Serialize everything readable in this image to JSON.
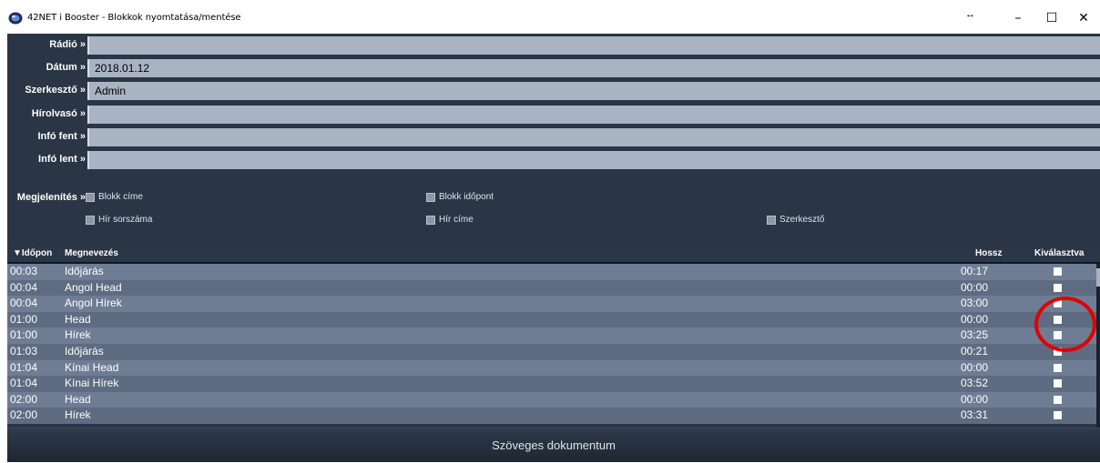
{
  "window": {
    "title": "42NET i Booster - Blokkok nyomtatása/mentése",
    "resize_glyph": "↔",
    "minimize_glyph": "–",
    "maximize_glyph": "☐",
    "close_glyph": "✕"
  },
  "form": {
    "fields": [
      {
        "label": "Rádió »",
        "value": ""
      },
      {
        "label": "Dátum »",
        "value": "2018.01.12"
      },
      {
        "label": "Szerkesztő »",
        "value": "Admin"
      },
      {
        "label": "Hírolvasó »",
        "value": ""
      },
      {
        "label": "Infó fent »",
        "value": ""
      },
      {
        "label": "Infó lent »",
        "value": ""
      }
    ]
  },
  "display": {
    "label": "Megjelenítés »",
    "options": [
      {
        "label": "Blokk címe",
        "checked": false
      },
      {
        "label": "Blokk időpont",
        "checked": false
      },
      {
        "label": "Hír sorszáma",
        "checked": false
      },
      {
        "label": "Hír címe",
        "checked": false
      },
      {
        "label": "Szerkesztő",
        "checked": false
      }
    ]
  },
  "grid": {
    "columns": {
      "time": "▼Időpon",
      "name": "Megnevezés",
      "length": "Hossz",
      "selected": "Kiválasztva"
    },
    "rows": [
      {
        "time": "00:03",
        "name": "Időjárás",
        "length": "00:17",
        "selected": true
      },
      {
        "time": "00:04",
        "name": "Angol Head",
        "length": "00:00",
        "selected": true
      },
      {
        "time": "00:04",
        "name": "Angol Hírek",
        "length": "03:00",
        "selected": true
      },
      {
        "time": "01:00",
        "name": "Head",
        "length": "00:00",
        "selected": true
      },
      {
        "time": "01:00",
        "name": "Hírek",
        "length": "03:25",
        "selected": true
      },
      {
        "time": "01:03",
        "name": "Időjárás",
        "length": "00:21",
        "selected": true
      },
      {
        "time": "01:04",
        "name": "Kínai Head",
        "length": "00:00",
        "selected": true
      },
      {
        "time": "01:04",
        "name": "Kínai Hírek",
        "length": "03:52",
        "selected": true
      },
      {
        "time": "02:00",
        "name": "Head",
        "length": "00:00",
        "selected": true
      },
      {
        "time": "02:00",
        "name": "Hírek",
        "length": "03:31",
        "selected": true
      }
    ]
  },
  "footer": {
    "button_label": "Szöveges dokumentum"
  },
  "colors": {
    "background": "#2a3645",
    "field": "#a9b4c3",
    "row_odd": "#6e7d94",
    "row_even": "#5e6b80",
    "annotation": "#e00000"
  }
}
